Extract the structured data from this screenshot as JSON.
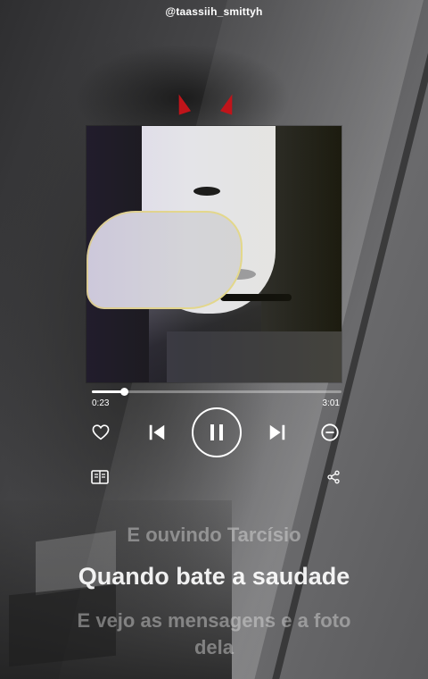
{
  "header": {
    "handle": "@taassiih_smittyh"
  },
  "player": {
    "elapsed": "0:23",
    "duration": "3:01",
    "progress_fraction": 0.13
  },
  "icons": {
    "like": "heart-icon",
    "previous": "skip-previous-icon",
    "pause": "pause-icon",
    "next": "skip-next-icon",
    "remove": "minus-circle-icon",
    "lyrics": "lyrics-icon",
    "share": "share-icon"
  },
  "lyrics": {
    "previous_line": "E ouvindo Tarcísio",
    "current_line": "Quando bate a saudade",
    "next_line": "E vejo as mensagens e a foto dela"
  },
  "colors": {
    "accent": "#ffffff",
    "horns": "#c0141a"
  }
}
